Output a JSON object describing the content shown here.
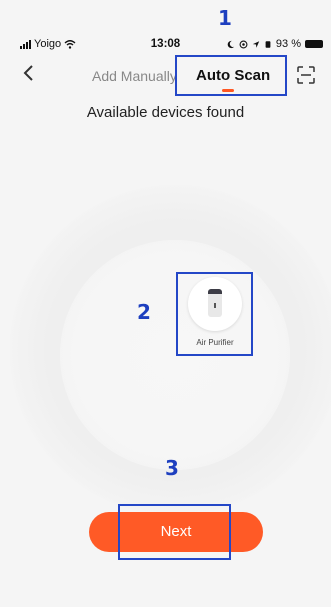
{
  "status_bar": {
    "carrier": "Yoigo",
    "time": "13:08",
    "battery_percent": "93 %"
  },
  "header": {
    "tabs": [
      {
        "label": "Add Manually",
        "active": false
      },
      {
        "label": "Auto Scan",
        "active": true
      }
    ],
    "back_icon": "chevron-left-icon",
    "scan_icon": "scan-frame-icon"
  },
  "title": "Available devices found",
  "devices": [
    {
      "name": "Air Purifier",
      "icon": "air-purifier-icon"
    }
  ],
  "next_button": {
    "label": "Next"
  },
  "annotations": [
    "1",
    "2",
    "3"
  ],
  "colors": {
    "accent": "#ff5a26",
    "annotation": "#2447c7",
    "background": "#f5f5f5"
  }
}
